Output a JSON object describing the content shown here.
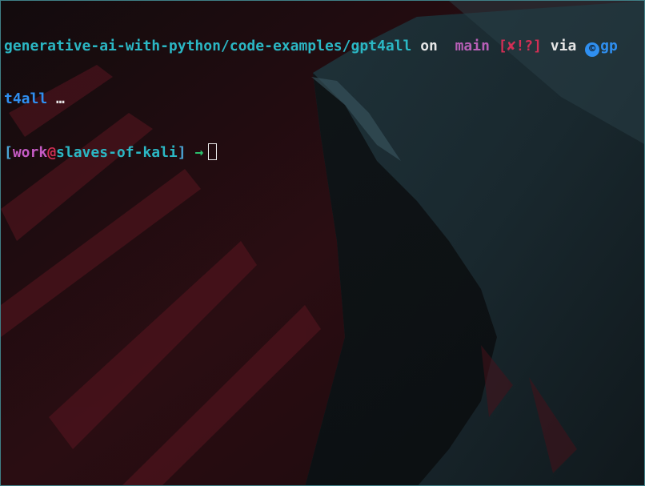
{
  "prompt": {
    "path": "generative-ai-with-python/code-examples/gpt4all",
    "on_label": "on",
    "git_icon_glyph": "",
    "git_icon_name": "git-branch-icon",
    "branch": "main",
    "status": "[✘!?]",
    "via_label": "via",
    "python_icon_glyph": "©",
    "python_icon_name": "python-icon",
    "env_part1": "gp",
    "env_part2": "t4all",
    "ellipsis": "…",
    "bracket_open": "[",
    "user": "work",
    "at": "@",
    "host": "slaves-of-kali",
    "bracket_close": "]",
    "arrow": "→"
  },
  "colors": {
    "path": "#2bb7c4",
    "branch": "#b85fb7",
    "status": "#d22f55",
    "python": "#2f8ff0",
    "arrow": "#2bbf6c",
    "border": "#3f7f86"
  }
}
